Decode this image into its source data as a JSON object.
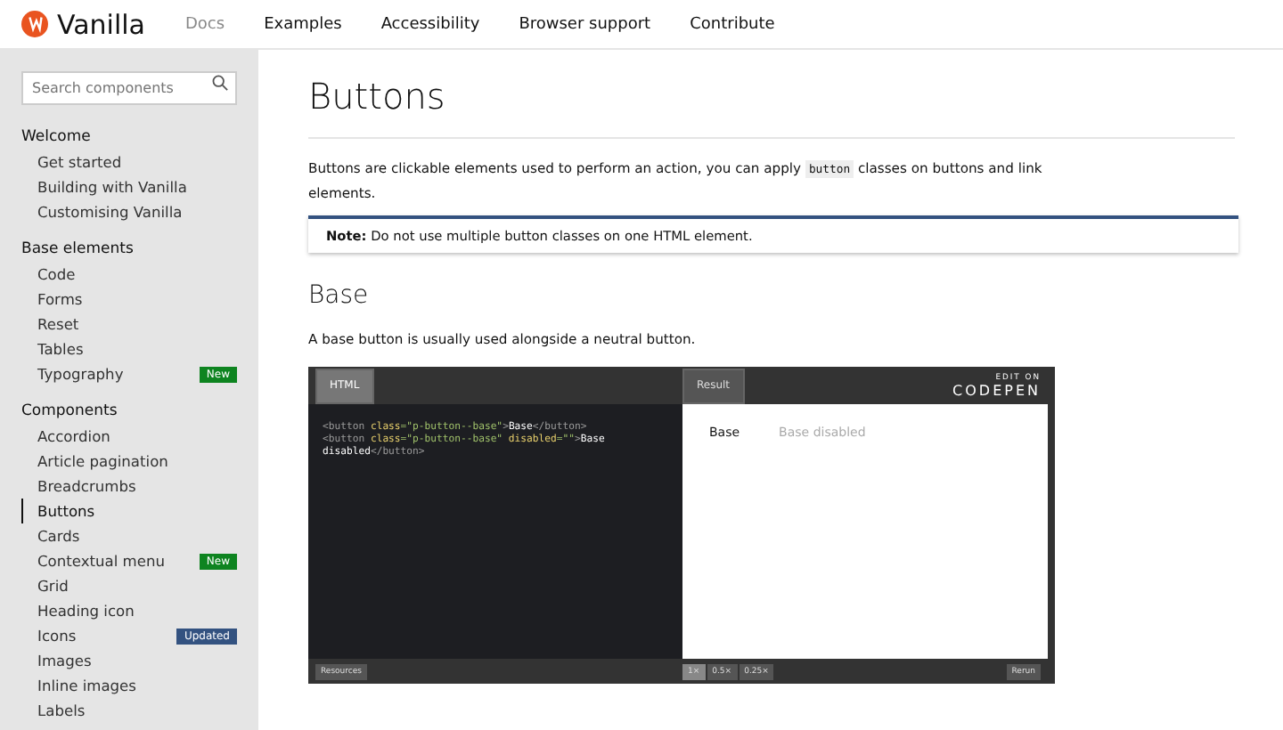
{
  "brand": "Vanilla",
  "nav": [
    {
      "label": "Docs",
      "selected": true
    },
    {
      "label": "Examples",
      "selected": false
    },
    {
      "label": "Accessibility",
      "selected": false
    },
    {
      "label": "Browser support",
      "selected": false
    },
    {
      "label": "Contribute",
      "selected": false
    }
  ],
  "sidebar": {
    "search": {
      "placeholder": "Search components"
    },
    "sections": [
      {
        "title": "Welcome",
        "items": [
          {
            "label": "Get started",
            "selected": false
          },
          {
            "label": "Building with Vanilla",
            "selected": false
          },
          {
            "label": "Customising Vanilla",
            "selected": false
          }
        ]
      },
      {
        "title": "Base elements",
        "items": [
          {
            "label": "Code",
            "selected": false
          },
          {
            "label": "Forms",
            "selected": false
          },
          {
            "label": "Reset",
            "selected": false
          },
          {
            "label": "Tables",
            "selected": false
          },
          {
            "label": "Typography",
            "selected": false,
            "badge": {
              "text": "New",
              "kind": "new"
            }
          }
        ]
      },
      {
        "title": "Components",
        "items": [
          {
            "label": "Accordion",
            "selected": false
          },
          {
            "label": "Article pagination",
            "selected": false
          },
          {
            "label": "Breadcrumbs",
            "selected": false
          },
          {
            "label": "Buttons",
            "selected": true
          },
          {
            "label": "Cards",
            "selected": false
          },
          {
            "label": "Contextual menu",
            "selected": false,
            "badge": {
              "text": "New",
              "kind": "new"
            }
          },
          {
            "label": "Grid",
            "selected": false
          },
          {
            "label": "Heading icon",
            "selected": false
          },
          {
            "label": "Icons",
            "selected": false,
            "badge": {
              "text": "Updated",
              "kind": "updated"
            }
          },
          {
            "label": "Images",
            "selected": false
          },
          {
            "label": "Inline images",
            "selected": false
          },
          {
            "label": "Labels",
            "selected": false
          }
        ]
      }
    ]
  },
  "page": {
    "title": "Buttons",
    "intro_before": "Buttons are clickable elements used to perform an action, you can apply ",
    "intro_code": "button",
    "intro_after": " classes on buttons and link elements.",
    "note": "**Note:** Do not use multiple button classes on one HTML element.",
    "section_title": "Base",
    "section_text": "A base button is usually used alongside a neutral button.",
    "embed": {
      "tabs": [
        {
          "label": "HTML",
          "selected": true
        },
        {
          "label": "Result",
          "selected": false
        }
      ],
      "edit_on": "EDIT ON",
      "codepen": "CODEPEN",
      "code_lines": [
        [
          {
            "t": "<button ",
            "kind": "tag"
          },
          {
            "t": "class",
            "kind": "attr"
          },
          {
            "t": "=\"p-button--base\"",
            "kind": "str"
          },
          {
            "t": ">",
            "kind": "tag"
          },
          {
            "t": "Base",
            "kind": "text"
          },
          {
            "t": "</button>",
            "kind": "tag"
          }
        ],
        [
          {
            "t": "<button ",
            "kind": "tag"
          },
          {
            "t": "class",
            "kind": "attr"
          },
          {
            "t": "=\"p-button--base\" ",
            "kind": "str"
          },
          {
            "t": "disabled",
            "kind": "attr"
          },
          {
            "t": "=\"\"",
            "kind": "str"
          },
          {
            "t": ">",
            "kind": "tag"
          },
          {
            "t": "Base",
            "kind": "text"
          }
        ],
        [
          {
            "t": "disabled",
            "kind": "text"
          },
          {
            "t": "</button>",
            "kind": "tag"
          }
        ]
      ],
      "result_buttons": [
        {
          "label": "Base",
          "disabled": false
        },
        {
          "label": "Base disabled",
          "disabled": true
        }
      ],
      "resources": "Resources",
      "zoom": [
        {
          "label": "1×",
          "selected": true
        },
        {
          "label": "0.5×",
          "selected": false
        },
        {
          "label": "0.25×",
          "selected": false
        }
      ],
      "rerun": "Rerun"
    }
  }
}
